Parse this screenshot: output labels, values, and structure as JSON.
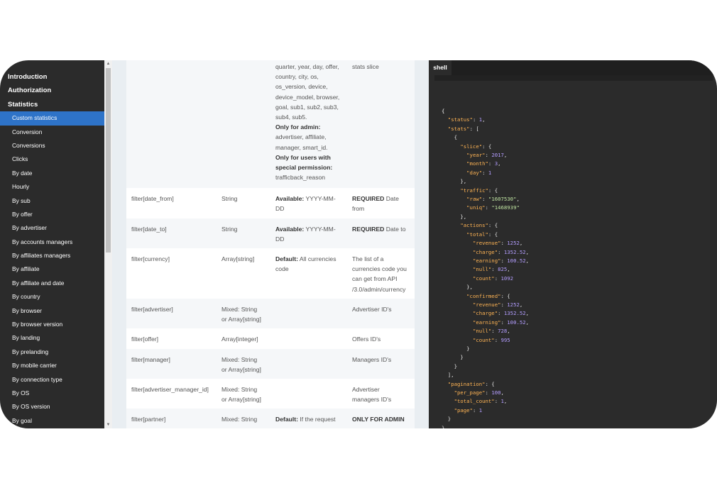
{
  "sidebar": {
    "sections": [
      "Introduction",
      "Authorization",
      "Statistics"
    ],
    "items": [
      {
        "label": "Custom statistics",
        "active": true
      },
      {
        "label": "Conversion"
      },
      {
        "label": "Conversions"
      },
      {
        "label": "Clicks"
      },
      {
        "label": "By date"
      },
      {
        "label": "Hourly"
      },
      {
        "label": "By sub"
      },
      {
        "label": "By offer"
      },
      {
        "label": "By advertiser"
      },
      {
        "label": "By accounts managers"
      },
      {
        "label": "By affiliates managers"
      },
      {
        "label": "By affiliate"
      },
      {
        "label": "By affiliate and date"
      },
      {
        "label": "By country"
      },
      {
        "label": "By browser"
      },
      {
        "label": "By browser version"
      },
      {
        "label": "By landing"
      },
      {
        "label": "By prelanding"
      },
      {
        "label": "By mobile carrier"
      },
      {
        "label": "By connection type"
      },
      {
        "label": "By OS"
      },
      {
        "label": "By OS version"
      },
      {
        "label": "By goal"
      }
    ],
    "active_color": "#2e73c8"
  },
  "table": {
    "rows": [
      {
        "name": "",
        "type": "",
        "values_lines": [
          "quarter, year, day, offer,",
          "country, city, os,",
          "os_version, device,",
          "device_model, browser,",
          "goal, sub1, sub2, sub3,",
          "sub4, sub5."
        ],
        "admin_label": "Only for admin:",
        "admin_lines": [
          "advertiser, affiliate,",
          "manager, smart_id."
        ],
        "perm_label_lines": [
          "Only for users with",
          "special permission:"
        ],
        "perm_value": "trafficback_reason",
        "desc": "stats slice"
      },
      {
        "name": "filter[date_from]",
        "type": "String",
        "label": "Available:",
        "value_lines": [
          "YYYY-MM-",
          "DD"
        ],
        "desc_bold": "REQUIRED",
        "desc_lines": [
          "Date",
          "from"
        ]
      },
      {
        "name": "filter[date_to]",
        "type": "String",
        "label": "Available:",
        "value_lines": [
          "YYYY-MM-",
          "DD"
        ],
        "desc_bold": "REQUIRED",
        "desc_lines": [
          "Date to"
        ]
      },
      {
        "name": "filter[currency]",
        "type": "Array[string]",
        "label": "Default:",
        "value_lines": [
          "All currencies",
          "code"
        ],
        "desc_lines": [
          "The list of a",
          "currencies code you",
          "can get from API",
          "/3.0/admin/currency"
        ]
      },
      {
        "name": "filter[advertiser]",
        "type_lines": [
          "Mixed: String",
          "or Array[string]"
        ],
        "desc_lines": [
          "Advertiser ID's"
        ]
      },
      {
        "name": "filter[offer]",
        "type": "Array[integer]",
        "desc_lines": [
          "Offers ID's"
        ]
      },
      {
        "name": "filter[manager]",
        "type_lines": [
          "Mixed: String",
          "or Array[string]"
        ],
        "desc_lines": [
          "Managers ID's"
        ]
      },
      {
        "name": "filter[advertiser_manager_id]",
        "type_lines": [
          "Mixed: String",
          "or Array[string]"
        ],
        "desc_lines": [
          "Advertiser",
          "managers ID's"
        ]
      },
      {
        "name": "filter[partner]",
        "type": "Mixed: String",
        "label": "Default:",
        "value_lines": [
          "If the request"
        ],
        "desc_bold": "ONLY FOR ADMIN"
      }
    ]
  },
  "shell": {
    "tab": "shell",
    "response": {
      "status": 1,
      "slice": {
        "year": 2017,
        "month": 3,
        "day": 1
      },
      "traffic": {
        "raw": "1607530",
        "uniq": "1468939"
      },
      "total": {
        "revenue": 1252,
        "charge": 1352.52,
        "earning": 100.52,
        "null": 825,
        "count": 1092
      },
      "confirmed": {
        "revenue": 1252,
        "charge": 1352.52,
        "earning": 100.52,
        "null": 728,
        "count": 995
      },
      "pagination": {
        "per_page": 100,
        "total_count": 1,
        "page": 1
      }
    },
    "colors": {
      "key": "#ffb454",
      "string": "#bfe3a1",
      "number": "#b39dff"
    }
  }
}
